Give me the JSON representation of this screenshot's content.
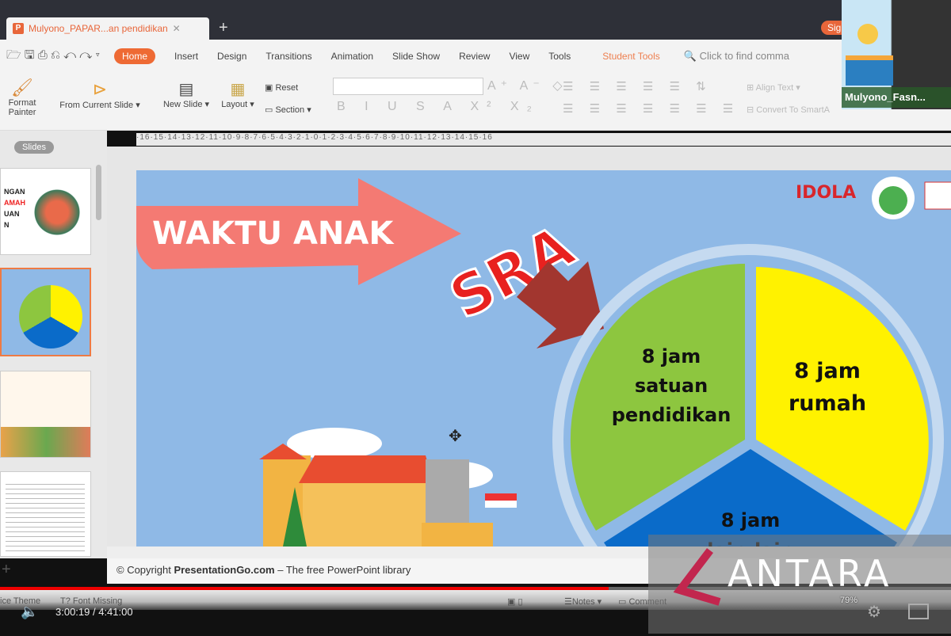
{
  "window": {
    "tab_title": "Mulyono_PAPAR...an pendidikan",
    "new_tab": "+",
    "sign_in": "Sig"
  },
  "menu": {
    "items": [
      "Home",
      "Insert",
      "Design",
      "Transitions",
      "Animation",
      "Slide Show",
      "Review",
      "View",
      "Tools"
    ],
    "student_tools": "Student Tools",
    "search_placeholder": "Click to find comma"
  },
  "ribbon": {
    "format_painter": "Format Painter",
    "from_current_slide": "From Current Slide",
    "new_slide": "New Slide",
    "layout": "Layout",
    "reset": "Reset",
    "section": "Section",
    "align_text": "Align Text",
    "convert_smartart": "Convert To SmartA"
  },
  "ruler": "·16·15·14·13·12·11·10·9·8·7·6·5·4·3·2·1·0·1·2·3·4·5·6·7·8·9·10·11·12·13·14·15·16",
  "left_pane": {
    "tab": "Slides",
    "add": "+"
  },
  "slide": {
    "banner": "WAKTU ANAK",
    "sra": "SRA",
    "logo": "IDOLA",
    "segments": [
      {
        "label": [
          "8 jam",
          "satuan",
          "pendidikan"
        ],
        "color": "#8dc63f"
      },
      {
        "label": [
          "8 jam",
          "rumah"
        ],
        "color": "#fff200"
      },
      {
        "label": [
          "8 jam",
          "lain-lain"
        ],
        "color": "#0a6bc9"
      }
    ]
  },
  "notes": {
    "prefix": "© Copyright ",
    "site": "PresentationGo.com",
    "suffix": " – The free PowerPoint library"
  },
  "status": {
    "theme": "ice Theme",
    "font_missing": "Font Missing",
    "notes": "Notes",
    "comment": "Comment",
    "zoom": "79%"
  },
  "video": {
    "time": "3:00:19 / 4:41:00",
    "progress": 0.64,
    "accent": "#ee0000"
  },
  "webcam": {
    "name": "Mulyono_Fasn..."
  },
  "watermark": "ANTARA"
}
